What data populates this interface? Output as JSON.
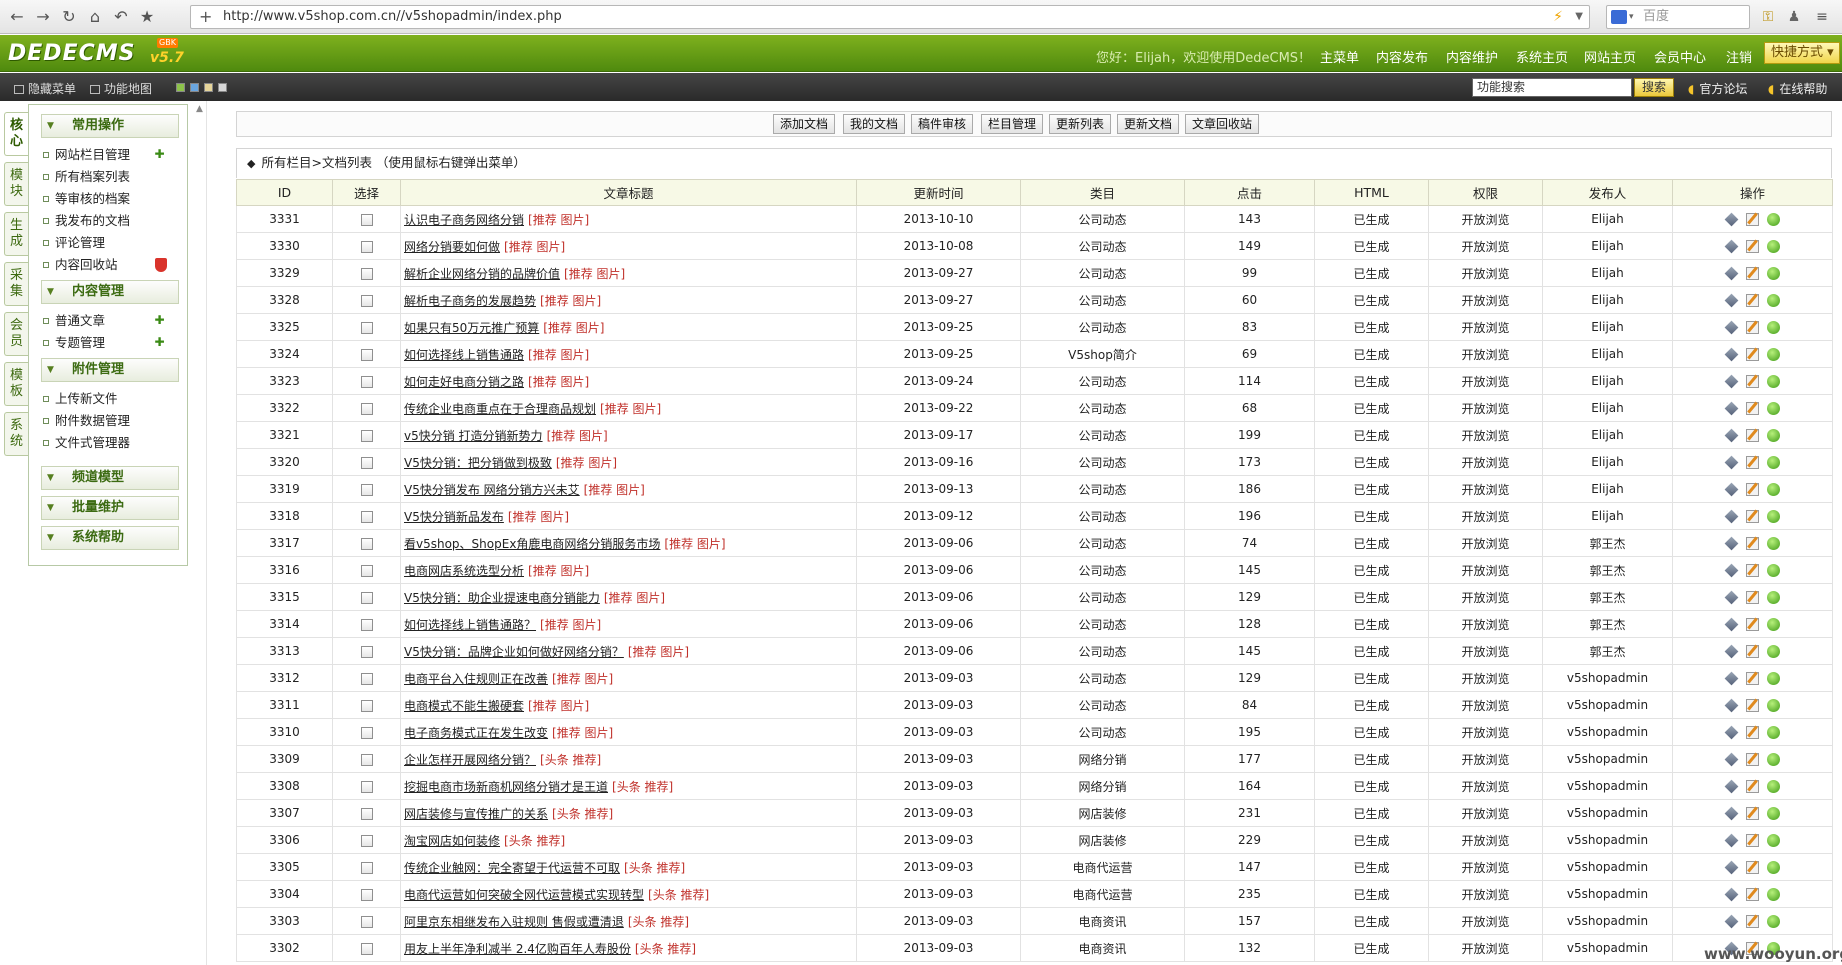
{
  "browser": {
    "url": "http://www.v5shop.com.cn//v5shopadmin/index.php",
    "search_engine_placeholder": "百度"
  },
  "header": {
    "logo": "DEDECMS",
    "version": "v5.7",
    "badge": "GBK",
    "welcome": "您好：Elijah，欢迎使用DedeCMS！",
    "menu": [
      "主菜单",
      "内容发布",
      "内容维护",
      "系统主页",
      "网站主页",
      "会员中心",
      "注销"
    ],
    "quick_menu": "快捷方式"
  },
  "subbar": {
    "hide_menu": "隐藏菜单",
    "func_map": "功能地图",
    "search_value": "功能搜索",
    "search_button": "搜索",
    "forum": "官方论坛",
    "help": "在线帮助"
  },
  "vtabs": [
    "核心",
    "模块",
    "生成",
    "采集",
    "会员",
    "模板",
    "系统"
  ],
  "left_menu": {
    "groups": [
      {
        "title": "常用操作",
        "items": [
          "网站栏目管理",
          "所有档案列表",
          "等审核的档案",
          "我发布的文档",
          "评论管理",
          "内容回收站"
        ]
      },
      {
        "title": "内容管理",
        "items": [
          "普通文章",
          "专题管理"
        ]
      },
      {
        "title": "附件管理",
        "items": [
          "上传新文件",
          "附件数据管理",
          "文件式管理器"
        ]
      },
      {
        "title": "频道模型",
        "items": []
      },
      {
        "title": "批量维护",
        "items": []
      },
      {
        "title": "系统帮助",
        "items": []
      }
    ]
  },
  "toolbar": [
    "添加文档",
    "我的文档",
    "稿件审核",
    "栏目管理",
    "更新列表",
    "更新文档",
    "文章回收站"
  ],
  "breadcrumb": "所有栏目>文档列表 （使用鼠标右键弹出菜单）",
  "table": {
    "columns": [
      "ID",
      "选择",
      "文章标题",
      "更新时间",
      "类目",
      "点击",
      "HTML",
      "权限",
      "发布人",
      "操作"
    ],
    "rows": [
      {
        "id": "3331",
        "title": "认识电子商务网络分销",
        "flags": "[推荐 图片]",
        "date": "2013-10-10",
        "cat": "公司动态",
        "clicks": "143",
        "html": "已生成",
        "perm": "开放浏览",
        "author": "Elijah"
      },
      {
        "id": "3330",
        "title": "网络分销要如何做",
        "flags": "[推荐 图片]",
        "date": "2013-10-08",
        "cat": "公司动态",
        "clicks": "149",
        "html": "已生成",
        "perm": "开放浏览",
        "author": "Elijah"
      },
      {
        "id": "3329",
        "title": "解析企业网络分销的品牌价值",
        "flags": "[推荐 图片]",
        "date": "2013-09-27",
        "cat": "公司动态",
        "clicks": "99",
        "html": "已生成",
        "perm": "开放浏览",
        "author": "Elijah"
      },
      {
        "id": "3328",
        "title": "解析电子商务的发展趋势",
        "flags": "[推荐 图片]",
        "date": "2013-09-27",
        "cat": "公司动态",
        "clicks": "60",
        "html": "已生成",
        "perm": "开放浏览",
        "author": "Elijah"
      },
      {
        "id": "3325",
        "title": "如果只有50万元推广预算",
        "flags": "[推荐 图片]",
        "date": "2013-09-25",
        "cat": "公司动态",
        "clicks": "83",
        "html": "已生成",
        "perm": "开放浏览",
        "author": "Elijah"
      },
      {
        "id": "3324",
        "title": "如何选择线上销售通路",
        "flags": "[推荐 图片]",
        "date": "2013-09-25",
        "cat": "V5shop简介",
        "clicks": "69",
        "html": "已生成",
        "perm": "开放浏览",
        "author": "Elijah"
      },
      {
        "id": "3323",
        "title": "如何走好电商分销之路",
        "flags": "[推荐 图片]",
        "date": "2013-09-24",
        "cat": "公司动态",
        "clicks": "114",
        "html": "已生成",
        "perm": "开放浏览",
        "author": "Elijah"
      },
      {
        "id": "3322",
        "title": "传统企业电商重点在于合理商品规划",
        "flags": "[推荐 图片]",
        "date": "2013-09-22",
        "cat": "公司动态",
        "clicks": "68",
        "html": "已生成",
        "perm": "开放浏览",
        "author": "Elijah"
      },
      {
        "id": "3321",
        "title": "v5快分销 打造分销新势力",
        "flags": "[推荐 图片]",
        "date": "2013-09-17",
        "cat": "公司动态",
        "clicks": "199",
        "html": "已生成",
        "perm": "开放浏览",
        "author": "Elijah"
      },
      {
        "id": "3320",
        "title": "V5快分销：把分销做到极致",
        "flags": "[推荐 图片]",
        "date": "2013-09-16",
        "cat": "公司动态",
        "clicks": "173",
        "html": "已生成",
        "perm": "开放浏览",
        "author": "Elijah"
      },
      {
        "id": "3319",
        "title": "V5快分销发布 网络分销方兴未艾",
        "flags": "[推荐 图片]",
        "date": "2013-09-13",
        "cat": "公司动态",
        "clicks": "186",
        "html": "已生成",
        "perm": "开放浏览",
        "author": "Elijah"
      },
      {
        "id": "3318",
        "title": "V5快分销新品发布",
        "flags": "[推荐 图片]",
        "date": "2013-09-12",
        "cat": "公司动态",
        "clicks": "196",
        "html": "已生成",
        "perm": "开放浏览",
        "author": "Elijah"
      },
      {
        "id": "3317",
        "title": "看v5shop、ShopEx角鹿电商网络分销服务市场",
        "flags": "[推荐 图片]",
        "date": "2013-09-06",
        "cat": "公司动态",
        "clicks": "74",
        "html": "已生成",
        "perm": "开放浏览",
        "author": "郭王杰"
      },
      {
        "id": "3316",
        "title": "电商网店系统选型分析",
        "flags": "[推荐 图片]",
        "date": "2013-09-06",
        "cat": "公司动态",
        "clicks": "145",
        "html": "已生成",
        "perm": "开放浏览",
        "author": "郭王杰"
      },
      {
        "id": "3315",
        "title": "V5快分销：助企业提速电商分销能力",
        "flags": "[推荐 图片]",
        "date": "2013-09-06",
        "cat": "公司动态",
        "clicks": "129",
        "html": "已生成",
        "perm": "开放浏览",
        "author": "郭王杰"
      },
      {
        "id": "3314",
        "title": "如何选择线上销售通路？",
        "flags": "[推荐 图片]",
        "date": "2013-09-06",
        "cat": "公司动态",
        "clicks": "128",
        "html": "已生成",
        "perm": "开放浏览",
        "author": "郭王杰"
      },
      {
        "id": "3313",
        "title": "V5快分销：品牌企业如何做好网络分销？",
        "flags": "[推荐 图片]",
        "date": "2013-09-06",
        "cat": "公司动态",
        "clicks": "145",
        "html": "已生成",
        "perm": "开放浏览",
        "author": "郭王杰"
      },
      {
        "id": "3312",
        "title": "电商平台入住规则正在改善",
        "flags": "[推荐 图片]",
        "date": "2013-09-03",
        "cat": "公司动态",
        "clicks": "129",
        "html": "已生成",
        "perm": "开放浏览",
        "author": "v5shopadmin"
      },
      {
        "id": "3311",
        "title": "电商模式不能生搬硬套",
        "flags": "[推荐 图片]",
        "date": "2013-09-03",
        "cat": "公司动态",
        "clicks": "84",
        "html": "已生成",
        "perm": "开放浏览",
        "author": "v5shopadmin"
      },
      {
        "id": "3310",
        "title": "电子商务模式正在发生改变",
        "flags": "[推荐 图片]",
        "date": "2013-09-03",
        "cat": "公司动态",
        "clicks": "195",
        "html": "已生成",
        "perm": "开放浏览",
        "author": "v5shopadmin"
      },
      {
        "id": "3309",
        "title": "企业怎样开展网络分销？",
        "flags": "[头条 推荐]",
        "date": "2013-09-03",
        "cat": "网络分销",
        "clicks": "177",
        "html": "已生成",
        "perm": "开放浏览",
        "author": "v5shopadmin"
      },
      {
        "id": "3308",
        "title": "挖掘电商市场新商机网络分销才是王道",
        "flags": "[头条 推荐]",
        "date": "2013-09-03",
        "cat": "网络分销",
        "clicks": "164",
        "html": "已生成",
        "perm": "开放浏览",
        "author": "v5shopadmin"
      },
      {
        "id": "3307",
        "title": "网店装修与宣传推广的关系",
        "flags": "[头条 推荐]",
        "date": "2013-09-03",
        "cat": "网店装修",
        "clicks": "231",
        "html": "已生成",
        "perm": "开放浏览",
        "author": "v5shopadmin"
      },
      {
        "id": "3306",
        "title": "淘宝网店如何装修",
        "flags": "[头条 推荐]",
        "date": "2013-09-03",
        "cat": "网店装修",
        "clicks": "229",
        "html": "已生成",
        "perm": "开放浏览",
        "author": "v5shopadmin"
      },
      {
        "id": "3305",
        "title": "传统企业触网：完全寄望于代运营不可取",
        "flags": "[头条 推荐]",
        "date": "2013-09-03",
        "cat": "电商代运营",
        "clicks": "147",
        "html": "已生成",
        "perm": "开放浏览",
        "author": "v5shopadmin"
      },
      {
        "id": "3304",
        "title": "电商代运营如何突破全网代运营模式实现转型",
        "flags": "[头条 推荐]",
        "date": "2013-09-03",
        "cat": "电商代运营",
        "clicks": "235",
        "html": "已生成",
        "perm": "开放浏览",
        "author": "v5shopadmin"
      },
      {
        "id": "3303",
        "title": "阿里京东相继发布入驻规则 售假或遭清退",
        "flags": "[头条 推荐]",
        "date": "2013-09-03",
        "cat": "电商资讯",
        "clicks": "157",
        "html": "已生成",
        "perm": "开放浏览",
        "author": "v5shopadmin"
      },
      {
        "id": "3302",
        "title": "用友上半年净利减半 2.4亿购百年人寿股份",
        "flags": "[头条 推荐]",
        "date": "2013-09-03",
        "cat": "电商资讯",
        "clicks": "132",
        "html": "已生成",
        "perm": "开放浏览",
        "author": "v5shopadmin"
      }
    ]
  },
  "watermark": "www.wooyun.org"
}
